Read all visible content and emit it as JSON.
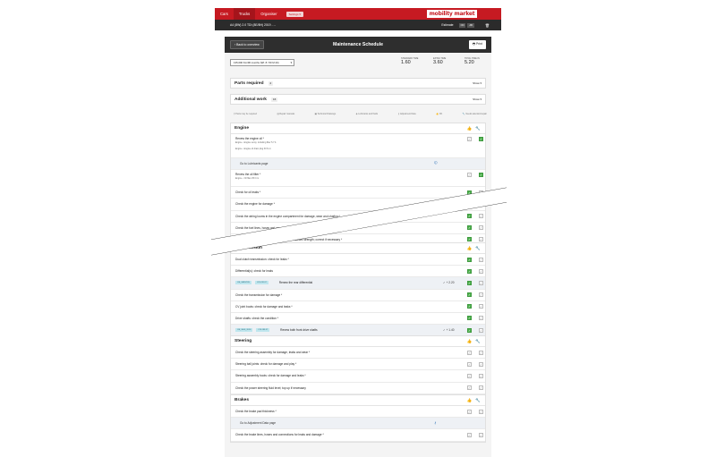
{
  "nav": {
    "tabs": [
      "Cars",
      "Trucks",
      "Organiser"
    ],
    "settings_label": "Settings",
    "brand": "mobility market"
  },
  "vehicle": {
    "name": "A4 (8W) 2.0 TDI (8E/8H) 2019 - ...",
    "estimate_label": "Estimate",
    "estimate_options": [
      "ON",
      "AB"
    ]
  },
  "header": {
    "back_label": "Back to overview",
    "title": "Maintenance Schedule",
    "print_label": "Print"
  },
  "filter": {
    "value": "135,000 Km/96 months (Wf. 8 / 50 M 20)"
  },
  "times": [
    {
      "label": "STANDARD TIME",
      "value": "1.60"
    },
    {
      "label": "EXTRA TIME",
      "value": "3.60"
    },
    {
      "label": "TOTAL TIME IN",
      "value": "5.20"
    }
  ],
  "parts": {
    "title": "Parts required",
    "badge": "2",
    "show": "Show"
  },
  "additional": {
    "title": "Additional work",
    "badge": "16",
    "show": "Show"
  },
  "legend": [
    "Parts may be required",
    "Repair manuals",
    "Technical Drawings",
    "Lubricants and fluids",
    "Adjustment Data",
    "OK",
    "Needs attention/repair"
  ],
  "engine": {
    "title": "Engine",
    "rows": [
      {
        "text": "Renew the engine oil",
        "sub1": "Engine - Engine sump, including filter 5.7 lt.",
        "sub2": "Engine - Engine oil drain plug 30 N·m",
        "left": false,
        "right": true
      },
      {
        "link": "Go to Lubricants page"
      },
      {
        "text": "Renew the oil filter",
        "sub1": "Engine - Oil filter 25 N·m",
        "left": false,
        "right": true
      },
      {
        "text": "Check for oil leaks",
        "left": true,
        "right": false
      },
      {
        "text": "Check the engine for damage",
        "left": false,
        "right": false
      },
      {
        "text": "Check the wiring looms in the engine compartment for damage, wear and chafing",
        "left": true,
        "right": false
      },
      {
        "text": "Check the fuel lines, hoses and connections for leaks",
        "left": true,
        "right": false
      },
      {
        "text": "Coolant - Check the antifreeze protection and coolant strength; correct if necessary",
        "left": true,
        "right": false
      }
    ]
  },
  "transmission": {
    "title": "Transmission",
    "rows": [
      {
        "text": "Dual clutch transmission: check for leaks",
        "left": true,
        "right": false
      },
      {
        "text": "Differential(s): check for leaks",
        "left": true,
        "right": false
      },
      {
        "tag1": "OE_SERVICE",
        "tag2": "COLOR 07",
        "text": "Renew the rear differential",
        "delta": "+ 2.20",
        "left": true,
        "right": false
      },
      {
        "text": "Check the transmission for damage",
        "left": true,
        "right": false
      },
      {
        "text": "CV joint boots: check for damage and leaks",
        "left": true,
        "right": false
      },
      {
        "text": "Drive shafts: check the condition",
        "left": true,
        "right": false
      },
      {
        "tag1": "OE_SE-8_2016",
        "tag2": "COLOR 07",
        "text": "Renew both front drive shafts",
        "delta": "+ 1.40",
        "left": true,
        "right": false
      }
    ]
  },
  "steering": {
    "title": "Steering",
    "rows": [
      {
        "text": "Check the steering assembly for damage, leaks and wear",
        "left": false,
        "right": false
      },
      {
        "text": "Steering ball joints: check for damage and play",
        "left": false,
        "right": false
      },
      {
        "text": "Steering assembly boots: check for damage and leaks",
        "left": false,
        "right": false
      },
      {
        "text": "Check the power steering fluid level; top up if necessary",
        "left": false,
        "right": false
      }
    ]
  },
  "brakes": {
    "title": "Brakes",
    "rows": [
      {
        "text": "Check the brake pad thickness",
        "left": false,
        "right": false
      },
      {
        "link": "Go to Adjustment Data page"
      },
      {
        "text": "Check the brake lines, hoses and connections for leaks and damage",
        "left": false,
        "right": false
      }
    ]
  }
}
